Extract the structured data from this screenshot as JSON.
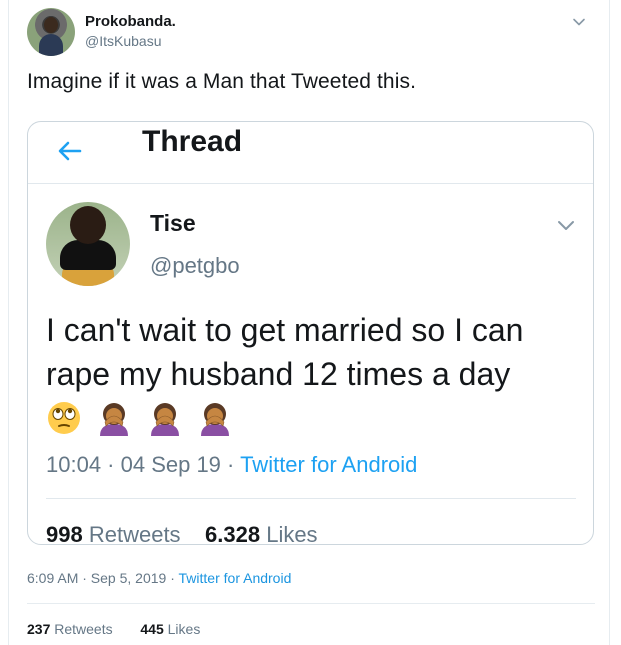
{
  "tweet": {
    "display_name": "Prokobanda.",
    "handle": "@ItsKubasu",
    "text": "Imagine if it was a Man that Tweeted this.",
    "timestamp": "6:09 AM · Sep 5, 2019",
    "separator": " · ",
    "source": "Twitter for Android",
    "retweets_count": "237",
    "retweets_label": "Retweets",
    "likes_count": "445",
    "likes_label": "Likes"
  },
  "embedded": {
    "header_title": "Thread",
    "display_name": "Tise",
    "handle": "@petgbo",
    "text": "I can't wait to get married so I can rape my husband 12 times a day",
    "emojis": [
      "face-with-rolling-eyes",
      "woman-facepalming",
      "woman-facepalming",
      "woman-facepalming"
    ],
    "timestamp": "10:04 · 04 Sep 19",
    "separator": " · ",
    "source": "Twitter for Android",
    "retweets_count": "998",
    "retweets_label": "Retweets",
    "likes_count": "6.328",
    "likes_label": "Likes"
  },
  "colors": {
    "accent": "#1da1f2",
    "muted": "#657786",
    "text": "#14171a"
  }
}
